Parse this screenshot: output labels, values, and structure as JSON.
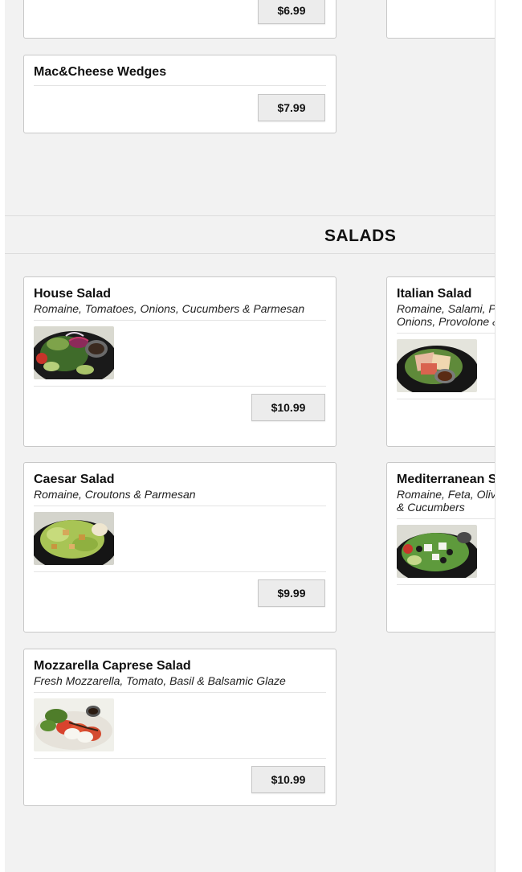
{
  "top_items": [
    {
      "price": "$6.99"
    },
    {
      "name": "Mac&Cheese Wedges",
      "price": "$7.99"
    }
  ],
  "section": {
    "title": "SALADS"
  },
  "salads": [
    {
      "name": "House Salad",
      "desc": "Romaine, Tomatoes, Onions, Cucumbers & Parmesan",
      "price": "$10.99"
    },
    {
      "name": "Italian Salad",
      "desc_line1": "Romaine, Salami, P",
      "desc_line2": "Onions, Provolone &"
    },
    {
      "name": "Caesar Salad",
      "desc": "Romaine, Croutons & Parmesan",
      "price": "$9.99"
    },
    {
      "name": "Mediterranean S",
      "desc_line1": "Romaine, Feta, Oliv",
      "desc_line2": "& Cucumbers"
    },
    {
      "name": "Mozzarella Caprese Salad",
      "desc": "Fresh Mozzarella, Tomato, Basil & Balsamic Glaze",
      "price": "$10.99"
    }
  ],
  "colors": {
    "background": "#f2f2f2",
    "card": "#ffffff",
    "button": "#ececec"
  }
}
